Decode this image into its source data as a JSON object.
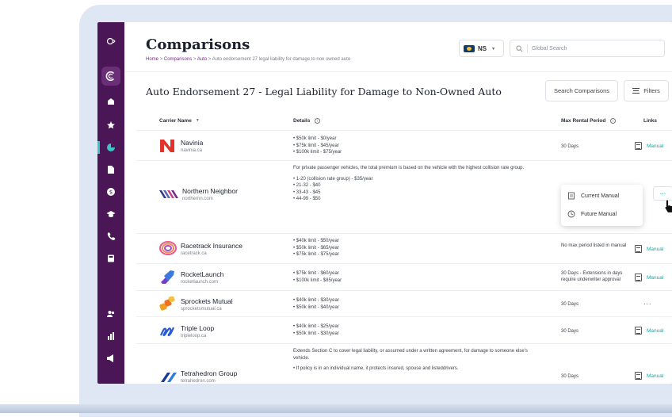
{
  "header": {
    "title": "Comparisons",
    "breadcrumb": [
      "Home",
      "Comparisons",
      "Auto",
      "Auto endorsement 27 legal liability for damage to non owned auto"
    ],
    "breadcrumb_sep": ">",
    "region": "NS",
    "search_placeholder": "Global Search"
  },
  "section": {
    "title": "Auto Endorsement 27 - Legal Liability for Damage to Non-Owned Auto",
    "search_button": "Search Comparisons",
    "filters_button": "Filters"
  },
  "table": {
    "columns": [
      "Carrier Name",
      "Details",
      "Max Rental Period",
      "Links"
    ],
    "rows": [
      {
        "name": "Navinia",
        "domain": "navinia.ca",
        "details_text": "",
        "details": [
          "$50k limit - $0/year",
          "$75k limit - $45/year",
          "$100k limit - $75/year"
        ],
        "rental": "30 Days",
        "link": "Manual"
      },
      {
        "name": "Northern Neighbor",
        "domain": "northernn.com",
        "details_text": "For private passenger vehicles, the total premium is based on the vehicle with the highest collision rate group.",
        "details": [
          "1-20 (collision rate group) - $35/year",
          "21-32 - $40",
          "33-43 - $45",
          "44-99 - $50"
        ],
        "rental": "",
        "link": ""
      },
      {
        "name": "Racetrack Insurance",
        "domain": "racetrack.ca",
        "details_text": "",
        "details": [
          "$40k limit - $50/year",
          "$50k limit - $65/year",
          "$75k limit - $75/year"
        ],
        "rental": "No max period listed in manual",
        "link": "Manual"
      },
      {
        "name": "RocketLaunch",
        "domain": "rocketlaunch.com",
        "details_text": "",
        "details": [
          "$75k limit - $60/year",
          "$100k limit - $85/year"
        ],
        "rental": "30 Days - Extensions in days require underwriter approval",
        "link": "Manual"
      },
      {
        "name": "Sprockets Mutual",
        "domain": "sprocketsmutual.ca",
        "details_text": "",
        "details": [
          "$40k limit - $30/year",
          "$50k limit - $40/year"
        ],
        "rental": "30 Days",
        "link": "..."
      },
      {
        "name": "Triple Loop",
        "domain": "tripleloop.ca",
        "details_text": "",
        "details": [
          "$40k limit - $25/year",
          "$50k limit - $30/year"
        ],
        "rental": "30 Days",
        "link": "Manual"
      },
      {
        "name": "Tetrahedron Group",
        "domain": "tetrahedron.com",
        "details_text": "Extends Section C to cover legal liability, or assumed under a written agreement, for damage to someone else's vehicle.",
        "details": [
          "If policy is in an individual name, it protects insured, spouse and listeddrivers."
        ],
        "rental": "30 Days",
        "link": "Manual"
      }
    ]
  },
  "popup": {
    "items": [
      "Current Manual",
      "Future Manual"
    ],
    "trigger": "..."
  },
  "colors": {
    "sidebar": "#4a1655",
    "accent": "#1fa2a2",
    "breadcrumb_link": "#7a2a8a"
  }
}
